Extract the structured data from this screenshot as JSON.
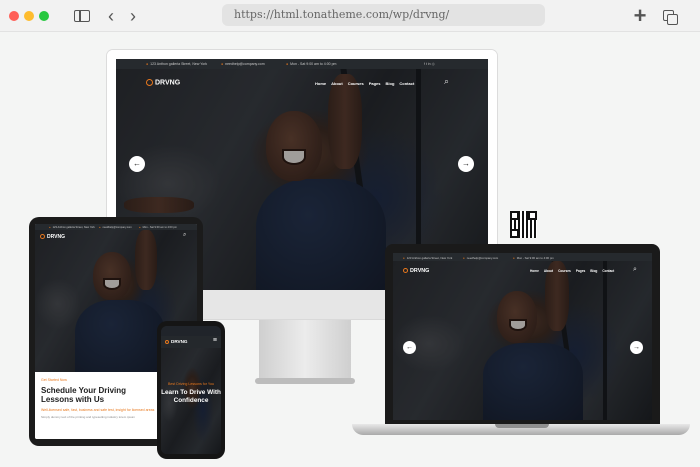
{
  "browser": {
    "url": "https://html.tonatheme.com/wp/drvng/",
    "back": "‹",
    "forward": "›",
    "new_tab": "+"
  },
  "site": {
    "logo_text": "DRVNG",
    "topbar": {
      "address": "123 Anthon galleria Street, New York",
      "email": "needhelp@company.com",
      "phone": "Mon - Sat 9:00 am to 4:00 pm"
    },
    "menu": [
      "Home",
      "About",
      "Courses",
      "Pages",
      "Blog",
      "Contact"
    ],
    "arrow_prev": "←",
    "arrow_next": "→",
    "search_icon": "⌕",
    "social": "f  t  in  ◎"
  },
  "tablet": {
    "kicker": "Get Started Now",
    "headline": "Schedule Your Driving Lessons with Us",
    "orange_line": "Well-licensed safe, fast, business and safe test, insight for licensed areas",
    "grey_line": "Simply dummy text of the printing and typesetting industry lorem ipsum"
  },
  "phone": {
    "kicker": "Best Driving Lessons for You",
    "title": "Learn To Drive With Confidence",
    "menu_icon": "≡"
  },
  "colors": {
    "accent": "#e8781d",
    "dark": "#1e2226"
  },
  "icons": [
    "sidebar-icon",
    "back-icon",
    "forward-icon",
    "plus-icon",
    "copy-icon",
    "search-icon",
    "qr-code-icon"
  ]
}
